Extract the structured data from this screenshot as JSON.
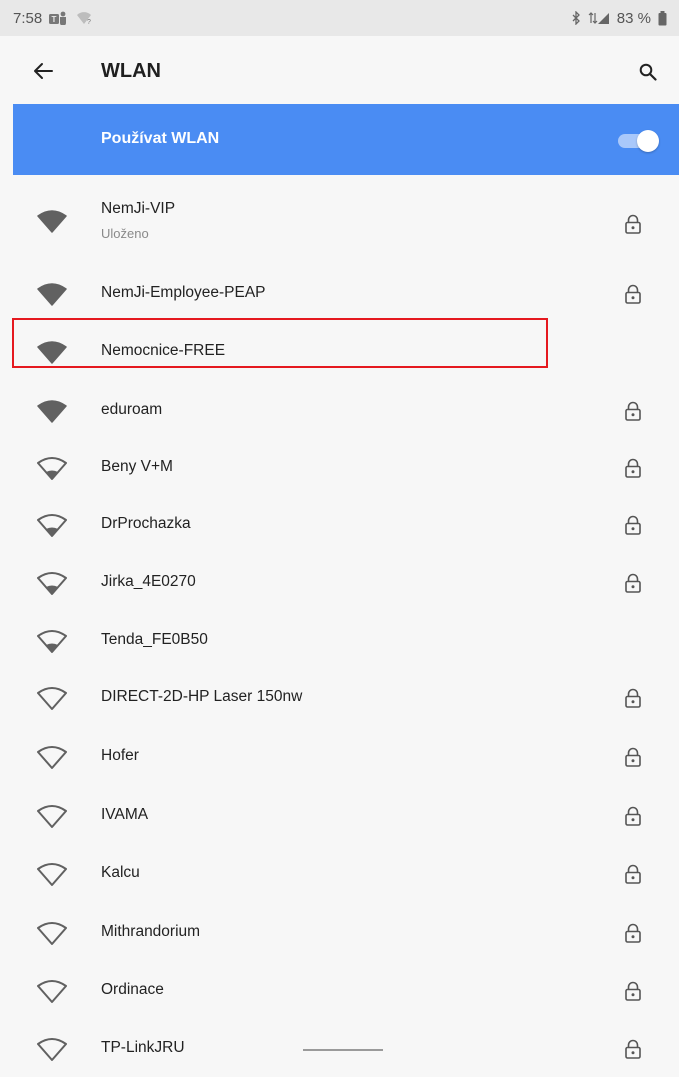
{
  "status_bar": {
    "time": "7:58",
    "battery": "83 %"
  },
  "app_bar": {
    "title": "WLAN"
  },
  "master_toggle": {
    "label": "Používat WLAN",
    "on": true
  },
  "networks": [
    {
      "name": "NemJi-VIP",
      "subtitle": "Uloženo",
      "signal": "full",
      "secured": true
    },
    {
      "name": "NemJi-Employee-PEAP",
      "subtitle": "",
      "signal": "full",
      "secured": true
    },
    {
      "name": "Nemocnice-FREE",
      "subtitle": "",
      "signal": "full",
      "secured": false
    },
    {
      "name": "eduroam",
      "subtitle": "",
      "signal": "full",
      "secured": true
    },
    {
      "name": "Beny V+M",
      "subtitle": "",
      "signal": "weak",
      "secured": true
    },
    {
      "name": "DrProchazka",
      "subtitle": "",
      "signal": "weak",
      "secured": true
    },
    {
      "name": "Jirka_4E0270",
      "subtitle": "",
      "signal": "weak",
      "secured": true
    },
    {
      "name": "Tenda_FE0B50",
      "subtitle": "",
      "signal": "weak",
      "secured": false
    },
    {
      "name": "DIRECT-2D-HP Laser 150nw",
      "subtitle": "",
      "signal": "none",
      "secured": true
    },
    {
      "name": "Hofer",
      "subtitle": "",
      "signal": "none",
      "secured": true
    },
    {
      "name": "IVAMA",
      "subtitle": "",
      "signal": "none",
      "secured": true
    },
    {
      "name": "Kalcu",
      "subtitle": "",
      "signal": "none",
      "secured": true
    },
    {
      "name": "Mithrandorium",
      "subtitle": "",
      "signal": "none",
      "secured": true
    },
    {
      "name": "Ordinace",
      "subtitle": "",
      "signal": "none",
      "secured": true
    },
    {
      "name": "TP-LinkJRU",
      "subtitle": "",
      "signal": "none",
      "secured": true
    }
  ],
  "colors": {
    "accent": "#4a8cf3",
    "highlight": "#e5191f",
    "icon": "#616161"
  }
}
